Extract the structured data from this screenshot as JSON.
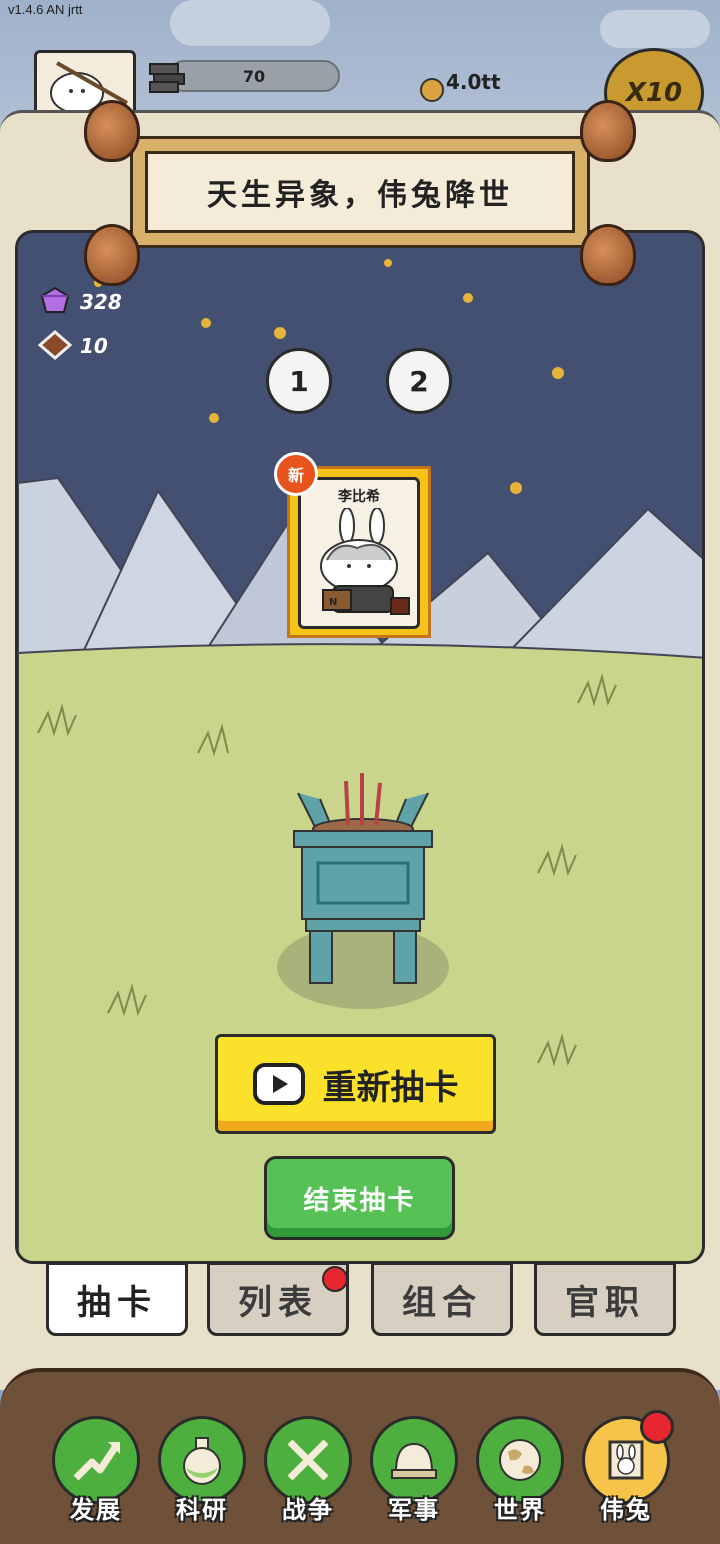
{
  "version": "v1.4.6 AN jrtt",
  "hud": {
    "iron_value": "70",
    "coin_value": "4.0tt",
    "multiplier": "X10"
  },
  "banner": {
    "title": "天生异象，伟兔降世"
  },
  "currencies": {
    "gems": "328",
    "tickets": "10"
  },
  "pages": [
    "1",
    "2"
  ],
  "card": {
    "name": "李比希",
    "badge": "新",
    "book_letter": "N"
  },
  "buttons": {
    "redraw": "重新抽卡",
    "end": "结束抽卡"
  },
  "tabs": [
    {
      "label": "抽卡",
      "active": true
    },
    {
      "label": "列表",
      "active": false,
      "badge": true
    },
    {
      "label": "组合",
      "active": false
    },
    {
      "label": "官职",
      "active": false
    }
  ],
  "nav": [
    {
      "label": "发展",
      "icon": "growth-arrow-icon"
    },
    {
      "label": "科研",
      "icon": "flask-icon"
    },
    {
      "label": "战争",
      "icon": "crossed-swords-icon"
    },
    {
      "label": "军事",
      "icon": "helmet-icon"
    },
    {
      "label": "世界",
      "icon": "globe-icon"
    },
    {
      "label": "伟兔",
      "icon": "rabbit-portrait-icon",
      "active": true,
      "badge": true
    }
  ],
  "colors": {
    "yellow_button": "#fbe12a",
    "green_button": "#56c154",
    "badge_red": "#e8262f",
    "nav_green": "#4caf3e"
  }
}
